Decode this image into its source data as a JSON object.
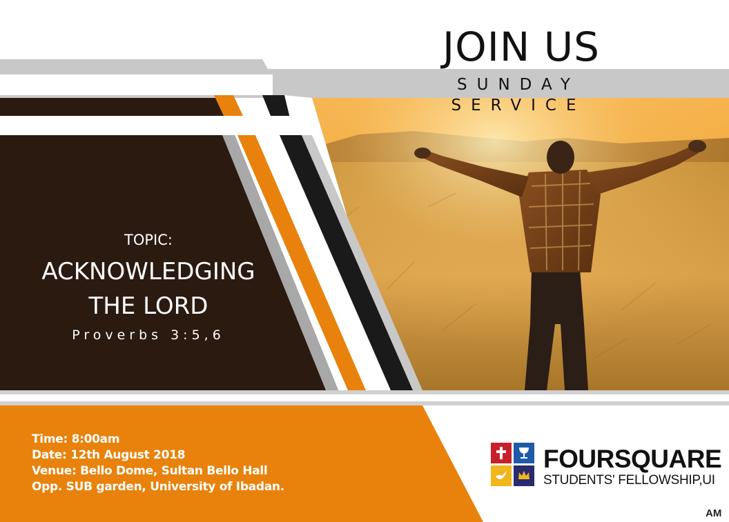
{
  "header": {
    "title": "JOIN US",
    "subtitle": "SUNDAY SERVICE"
  },
  "topic": {
    "label": "TOPIC:",
    "title_line1": "ACKNOWLEDGING",
    "title_line2": "THE LORD",
    "scripture": "Proverbs 3:5,6"
  },
  "details": {
    "time": "Time: 8:00am",
    "date": "Date: 12th August 2018",
    "venue": "Venue: Bello Dome, Sultan Bello Hall",
    "venue_line2": "Opp. SUB garden, University of Ibadan."
  },
  "logo": {
    "name": "FOURSQUARE",
    "tagline": "STUDENTS' FELLOWSHIP,UI",
    "icons": [
      "cross-icon",
      "cup-icon",
      "dove-icon",
      "crown-icon"
    ]
  },
  "signature": "AM",
  "photo": {
    "subject": "man-with-outstretched-arms-in-field"
  },
  "colors": {
    "brown": "#2b1a10",
    "orange": "#e8820c",
    "gray": "#c8c8c8",
    "black": "#1a1a1a",
    "logo_red": "#c8202a",
    "logo_blue": "#1e5aa8",
    "logo_yellow": "#f2b51c",
    "logo_navy": "#2a2a6e"
  }
}
